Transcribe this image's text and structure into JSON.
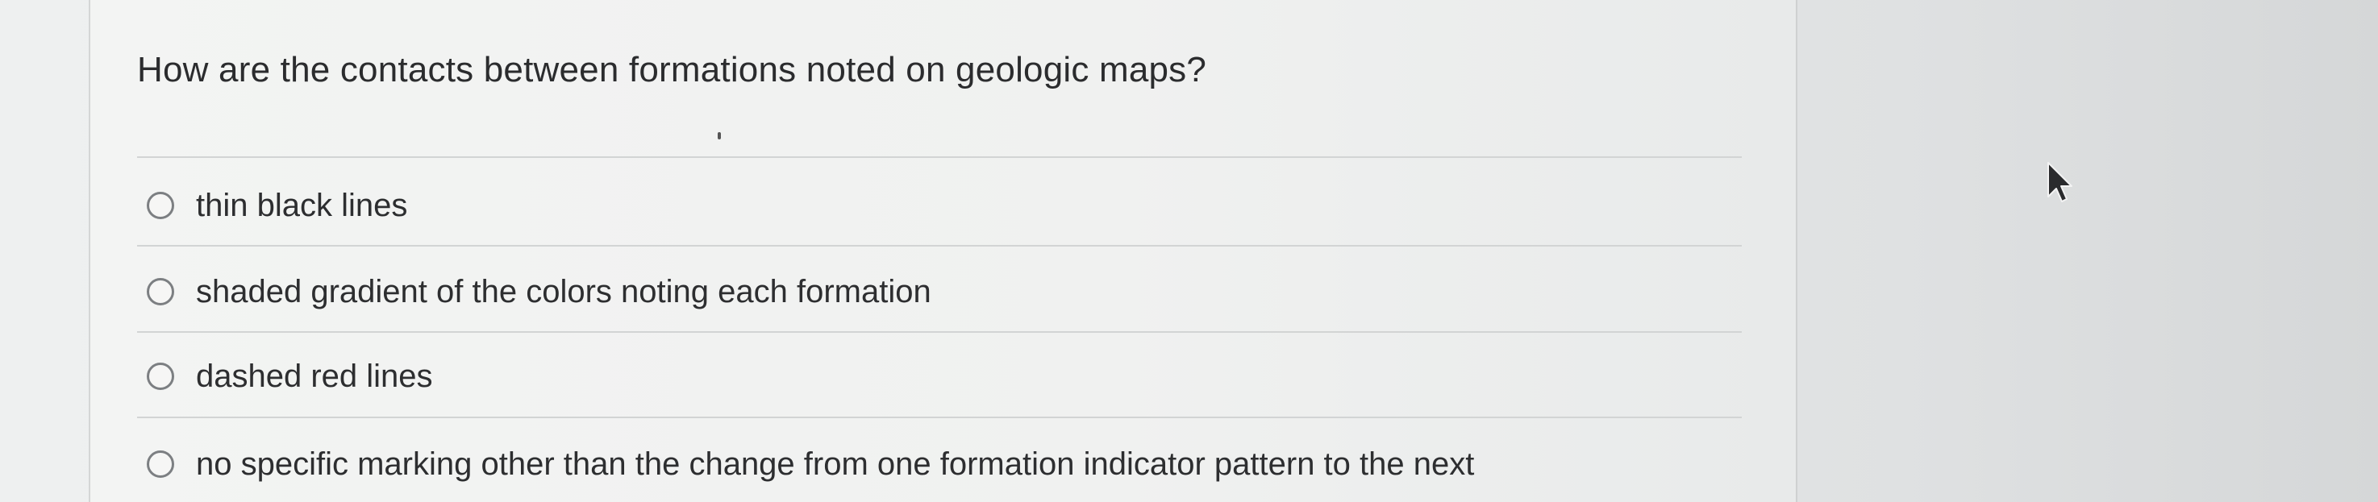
{
  "question": {
    "text": "How are the contacts between formations noted on geologic maps?"
  },
  "options": [
    {
      "label": "thin black lines",
      "selected": false
    },
    {
      "label": "shaded gradient of the colors noting each formation",
      "selected": false
    },
    {
      "label": "dashed red lines",
      "selected": false
    },
    {
      "label": "no specific marking other than the change from one formation indicator pattern to the next",
      "selected": false
    }
  ],
  "icons": {
    "radio": "radio-button-icon",
    "cursor": "mouse-pointer-icon"
  }
}
